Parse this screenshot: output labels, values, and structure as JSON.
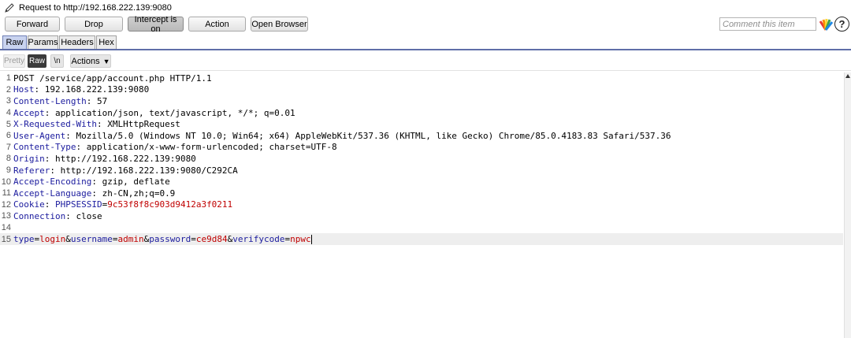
{
  "title": "Request to http://192.168.222.139:9080",
  "toolbar": {
    "forward": "Forward",
    "drop": "Drop",
    "intercept": "Intercept is on",
    "action": "Action",
    "open_browser": "Open Browser",
    "comment_placeholder": "Comment this item",
    "help": "?"
  },
  "tabs": [
    "Raw",
    "Params",
    "Headers",
    "Hex"
  ],
  "subbar": {
    "pretty": "Pretty",
    "raw": "Raw",
    "newline": "\\n",
    "actions": "Actions"
  },
  "request": {
    "line1": "POST /service/app/account.php HTTP/1.1",
    "headers": [
      {
        "name": "Host",
        "value": "192.168.222.139:9080"
      },
      {
        "name": "Content-Length",
        "value": "57"
      },
      {
        "name": "Accept",
        "value": "application/json, text/javascript, */*; q=0.01"
      },
      {
        "name": "X-Requested-With",
        "value": "XMLHttpRequest"
      },
      {
        "name": "User-Agent",
        "value": "Mozilla/5.0 (Windows NT 10.0; Win64; x64) AppleWebKit/537.36 (KHTML, like Gecko) Chrome/85.0.4183.83 Safari/537.36"
      },
      {
        "name": "Content-Type",
        "value": "application/x-www-form-urlencoded; charset=UTF-8"
      },
      {
        "name": "Origin",
        "value": "http://192.168.222.139:9080"
      },
      {
        "name": "Referer",
        "value": "http://192.168.222.139:9080/C292CA"
      },
      {
        "name": "Accept-Encoding",
        "value": "gzip, deflate"
      },
      {
        "name": "Accept-Language",
        "value": "zh-CN,zh;q=0.9"
      }
    ],
    "cookie": {
      "name": "Cookie",
      "cname": "PHPSESSID",
      "cvalue": "9c53f8f8c903d9412a3f0211"
    },
    "connection": {
      "name": "Connection",
      "value": "close"
    },
    "body": [
      {
        "k": "type",
        "v": "login"
      },
      {
        "k": "username",
        "v": "admin"
      },
      {
        "k": "password",
        "v": "ce9d84"
      },
      {
        "k": "verifycode",
        "v": "npwc"
      }
    ]
  },
  "colors": {
    "key": "#1b1b9e",
    "param_value": "#c00000",
    "tab_selected": "#c9d3ef"
  }
}
